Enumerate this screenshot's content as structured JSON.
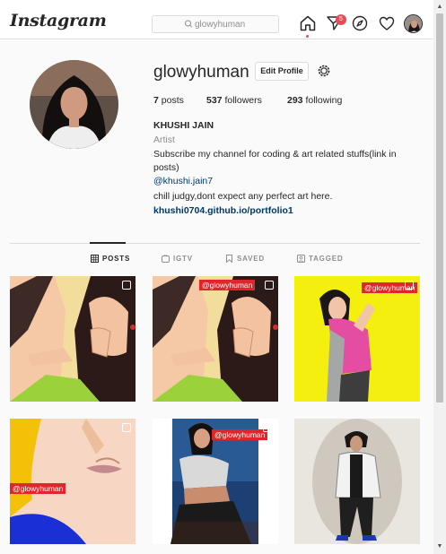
{
  "nav": {
    "logo": "Instagram",
    "search_value": "glowyhuman",
    "notification_count": "5",
    "icons": [
      "home-icon",
      "direct-message-icon",
      "explore-compass-icon",
      "activity-heart-icon",
      "profile-avatar"
    ]
  },
  "profile": {
    "username": "glowyhuman",
    "edit_label": "Edit Profile",
    "posts_count": "7",
    "posts_label": " posts",
    "followers_count": "537",
    "followers_label": " followers",
    "following_count": "293",
    "following_label": " following",
    "full_name": "KHUSHI JAIN",
    "category": "Artist",
    "bio": "Subscribe my channel for coding & art related stuffs(link in posts)",
    "mention": "@khushi.jain7",
    "bio_line2": "chill judgy,dont expect any perfect art here.",
    "website": "khushi0704.github.io/portfolio1"
  },
  "tabs": [
    {
      "label": "POSTS",
      "icon": "grid-icon",
      "active": true
    },
    {
      "label": "IGTV",
      "icon": "igtv-icon",
      "active": false
    },
    {
      "label": "SAVED",
      "icon": "bookmark-icon",
      "active": false
    },
    {
      "label": "TAGGED",
      "icon": "tagged-icon",
      "active": false
    }
  ],
  "posts": [
    {
      "watermark": ""
    },
    {
      "watermark": "@glowyhuman"
    },
    {
      "watermark": "@glowyhuman"
    },
    {
      "watermark": "@glowyhuman"
    },
    {
      "watermark": "@glowyhuman"
    },
    {
      "watermark": ""
    }
  ],
  "colors": {
    "accent_red": "#ed4956",
    "link_blue": "#00376b",
    "watermark_red": "#e0252b"
  }
}
